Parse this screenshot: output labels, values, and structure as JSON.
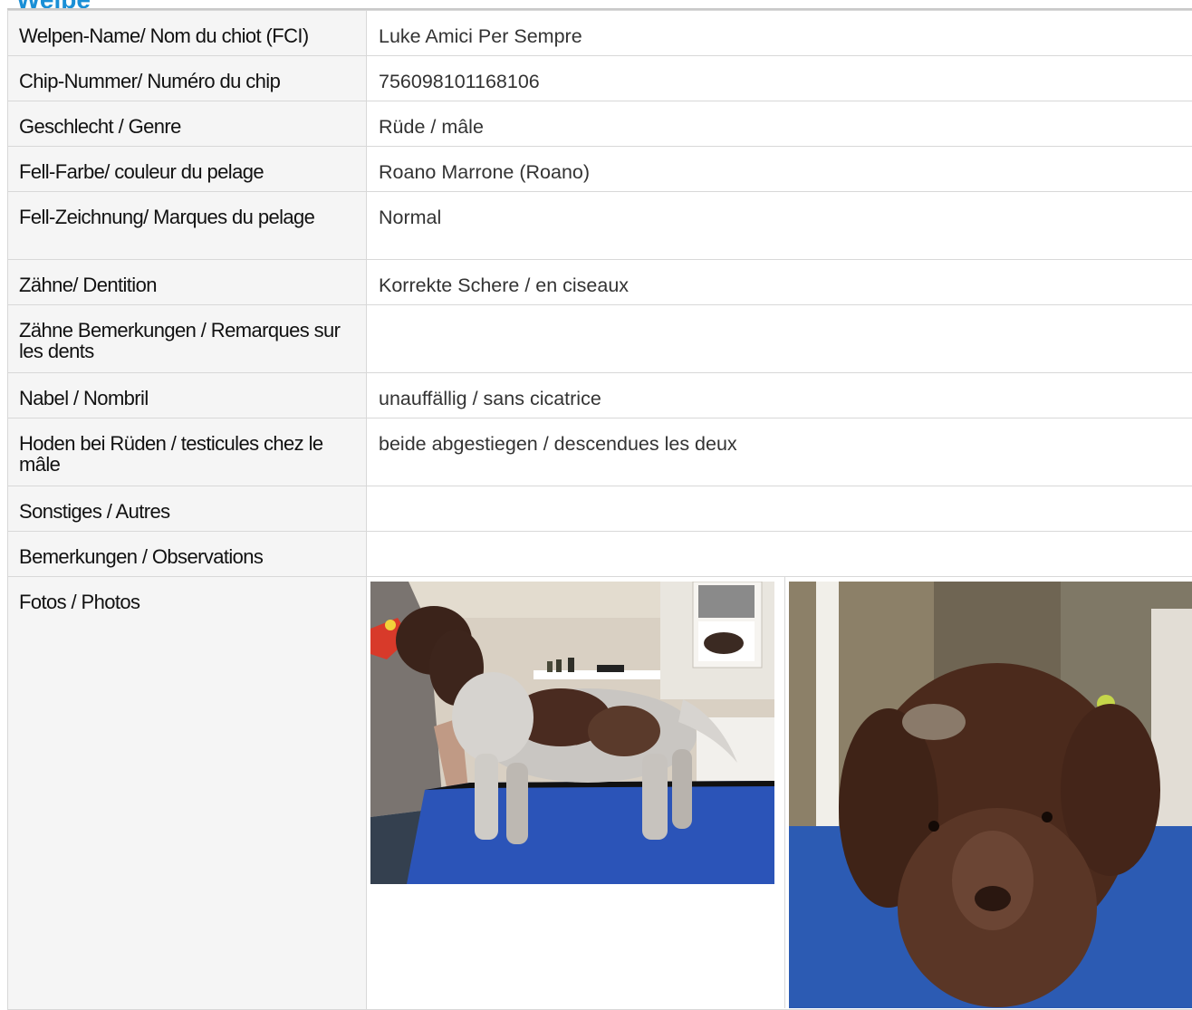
{
  "section": {
    "title": "Welpe"
  },
  "rows": [
    {
      "label": "Welpen-Name/ Nom du chiot (FCI)",
      "value": "Luke Amici Per Sempre"
    },
    {
      "label": "Chip-Nummer/ Numéro du chip",
      "value": "756098101168106"
    },
    {
      "label": "Geschlecht / Genre",
      "value": "Rüde / mâle"
    },
    {
      "label": "Fell-Farbe/ couleur du pelage",
      "value": "Roano Marrone (Roano)"
    },
    {
      "label": "Fell-Zeichnung/ Marques du pelage",
      "value": "Normal"
    },
    {
      "label": "Zähne/ Dentition",
      "value": "Korrekte Schere / en ciseaux"
    },
    {
      "label": "Zähne Bemerkungen / Remarques sur les dents",
      "value": ""
    },
    {
      "label": "Nabel / Nombril",
      "value": "unauffällig / sans cicatrice"
    },
    {
      "label": "Hoden bei Rüden / testicules chez le mâle",
      "value": "beide abgestiegen / descendues les deux"
    },
    {
      "label": "Sonstiges / Autres",
      "value": ""
    },
    {
      "label": "Bemerkungen / Observations",
      "value": ""
    },
    {
      "label": "Fotos / Photos",
      "value": ""
    }
  ],
  "photos": [
    {
      "icon": "puppy-standing-photo"
    },
    {
      "icon": "puppy-face-photo"
    }
  ],
  "colors": {
    "title": "#1a8fd6",
    "label_bg": "#f5f5f5",
    "border": "#d8d8d8",
    "table_blue": "#2b54b8"
  }
}
